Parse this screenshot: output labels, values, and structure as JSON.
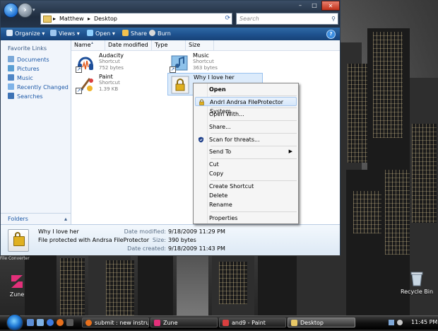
{
  "window": {
    "breadcrumb": [
      "Matthew",
      "Desktop"
    ],
    "search_placeholder": "Search",
    "controls": {
      "minimize": "–",
      "maximize": "□",
      "close": "✕"
    }
  },
  "toolbar": {
    "organize": "Organize",
    "views": "Views",
    "open": "Open",
    "share": "Share",
    "burn": "Burn",
    "help": "?"
  },
  "nav": {
    "heading": "Favorite Links",
    "links": [
      "Documents",
      "Pictures",
      "Music",
      "Recently Changed",
      "Searches"
    ],
    "folders": "Folders"
  },
  "columns": [
    "Name",
    "Date modified",
    "Type",
    "Size"
  ],
  "files": [
    {
      "name": "Audacity",
      "type": "Shortcut",
      "size": "752 bytes"
    },
    {
      "name": "Music",
      "type": "Shortcut",
      "size": "363 bytes"
    },
    {
      "name": "Paint",
      "type": "Shortcut",
      "size": "1.39 KB"
    },
    {
      "name": "Why I love her",
      "type": "",
      "size": ""
    }
  ],
  "context_menu": {
    "items": [
      {
        "label": "Open",
        "bold": true
      },
      {
        "label": "Andrl Andrsa FileProtector System"
      },
      {
        "label": "Open With..."
      },
      {
        "label": "Share..."
      },
      {
        "label": "Scan for threats..."
      },
      {
        "label": "Send To"
      },
      {
        "label": "Cut"
      },
      {
        "label": "Copy"
      },
      {
        "label": "Create Shortcut"
      },
      {
        "label": "Delete"
      },
      {
        "label": "Rename"
      },
      {
        "label": "Properties"
      }
    ]
  },
  "details": {
    "name": "Why I love her",
    "description": "File protected with Andrsa FileProtector",
    "date_modified_label": "Date modified:",
    "date_modified": "9/18/2009 11:29 PM",
    "size_label": "Size:",
    "size": "390 bytes",
    "date_created_label": "Date created:",
    "date_created": "9/18/2009 11:43 PM"
  },
  "desktop": {
    "partial_label": "File Converter",
    "icons": {
      "zune": "Zune",
      "recycle": "Recycle Bin"
    }
  },
  "taskbar": {
    "buttons": [
      "submit : new instruc...",
      "Zune",
      "and9 - Paint",
      "Desktop"
    ],
    "clock": "11:45 PM"
  },
  "colors": {
    "accent": "#1f5390",
    "selection": "#dcebfb",
    "link": "#1e5aa8"
  }
}
